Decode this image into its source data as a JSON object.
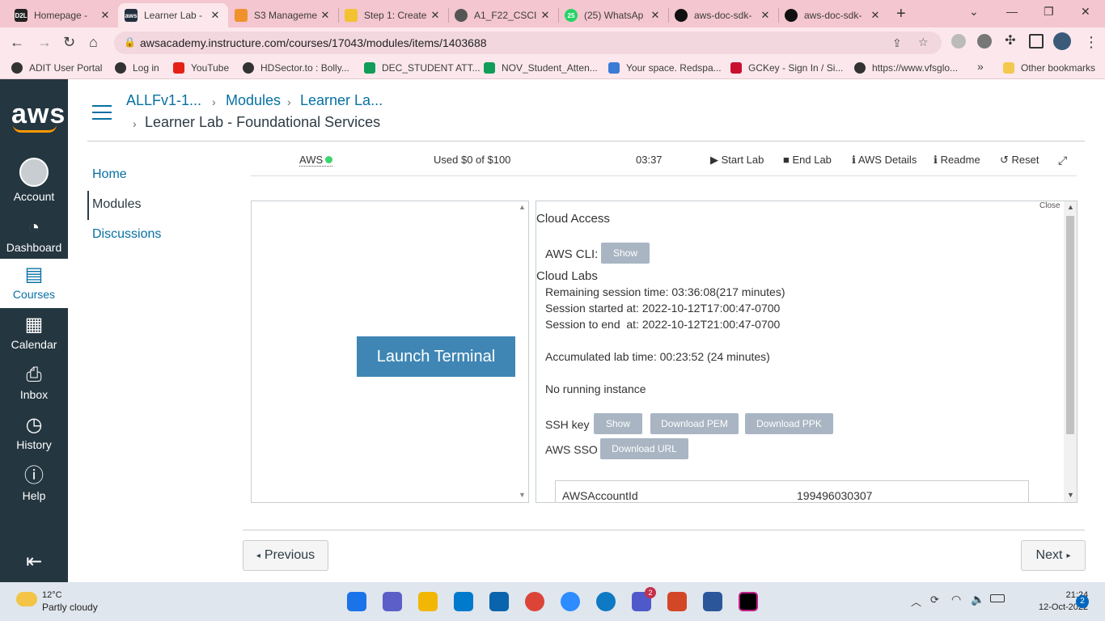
{
  "tabs": [
    {
      "title": "Homepage -",
      "fav_color": "#222",
      "fav_text": "D2L"
    },
    {
      "title": "Learner Lab -",
      "fav_color": "#232f3e",
      "fav_text": "aws"
    },
    {
      "title": "S3 Manageme",
      "fav_color": "#f0922b",
      "fav_text": ""
    },
    {
      "title": "Step 1: Create",
      "fav_color": "#f2c232",
      "fav_text": ""
    },
    {
      "title": "A1_F22_CSCI",
      "fav_color": "#555",
      "fav_text": ""
    },
    {
      "title": "(25) WhatsAp",
      "fav_color": "#25d366",
      "fav_text": "25"
    },
    {
      "title": "aws-doc-sdk-",
      "fav_color": "#111",
      "fav_text": ""
    },
    {
      "title": "aws-doc-sdk-",
      "fav_color": "#111",
      "fav_text": ""
    }
  ],
  "address": {
    "url": "awsacademy.instructure.com/courses/17043/modules/items/1403688"
  },
  "bookmarks": [
    {
      "label": "ADIT User Portal",
      "color": "#333"
    },
    {
      "label": "Log in",
      "color": "#333"
    },
    {
      "label": "YouTube",
      "color": "#e62117"
    },
    {
      "label": "HDSector.to : Bolly...",
      "color": "#333"
    },
    {
      "label": "DEC_STUDENT ATT...",
      "color": "#0f9d58"
    },
    {
      "label": "NOV_Student_Atten...",
      "color": "#0f9d58"
    },
    {
      "label": "Your space. Redspa...",
      "color": "#3a7bd5"
    },
    {
      "label": "GCKey - Sign In / Si...",
      "color": "#c8102e"
    },
    {
      "label": "https://www.vfsglo...",
      "color": "#333"
    }
  ],
  "bookmarks_overflow": "»",
  "other_bookmarks": "Other bookmarks",
  "globalnav": {
    "logo": "aws",
    "items": [
      {
        "label": "Account"
      },
      {
        "label": "Dashboard"
      },
      {
        "label": "Courses"
      },
      {
        "label": "Calendar"
      },
      {
        "label": "Inbox"
      },
      {
        "label": "History"
      },
      {
        "label": "Help"
      }
    ]
  },
  "breadcrumb": {
    "course": "ALLFv1-1...",
    "modules": "Modules",
    "item": "Learner La...",
    "title": "Learner Lab - Foundational Services"
  },
  "coursenav": {
    "home": "Home",
    "modules": "Modules",
    "discussions": "Discussions"
  },
  "labbar": {
    "aws": "AWS",
    "budget": "Used $0 of $100",
    "timer": "03:37",
    "start": "Start Lab",
    "end": "End Lab",
    "details": "AWS Details",
    "readme": "Readme",
    "reset": "Reset"
  },
  "left_panel": {
    "launch": "Launch Terminal"
  },
  "right_panel": {
    "close": "Close",
    "cloud_access": "Cloud Access",
    "aws_cli": "AWS CLI:",
    "show": "Show",
    "cloud_labs": "Cloud Labs",
    "remaining": "Remaining session time: 03:36:08(217 minutes)",
    "started": "Session started at: 2022-10-12T17:00:47-0700",
    "to_end": "Session to end  at: 2022-10-12T21:00:47-0700",
    "accumulated": "Accumulated lab time: 00:23:52 (24 minutes)",
    "no_instance": "No running instance",
    "ssh_key": "SSH key",
    "ssh_show": "Show",
    "download_pem": "Download PEM",
    "download_ppk": "Download PPK",
    "aws_sso": "AWS SSO",
    "download_url": "Download URL",
    "account_label": "AWSAccountId",
    "account_value": "199496030307"
  },
  "pager": {
    "previous": "Previous",
    "next": "Next"
  },
  "taskbar": {
    "temp": "12°C",
    "condition": "Partly cloudy",
    "time": "21:24",
    "date": "12-Oct-2022",
    "notif": "2",
    "teams_badge": "2"
  }
}
